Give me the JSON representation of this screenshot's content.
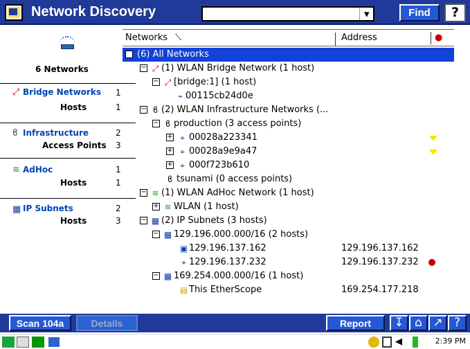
{
  "title": "Network Discovery",
  "search": {
    "placeholder": ""
  },
  "find": "Find",
  "help": "?",
  "left": {
    "count": "6 Networks",
    "bridge": "Bridge Networks",
    "bridge_count": "1",
    "bridge_hosts_label": "Hosts",
    "bridge_hosts": "1",
    "infra": "Infrastructure",
    "infra_count": "2",
    "infra_ap_label": "Access Points",
    "infra_ap": "3",
    "adhoc": "AdHoc",
    "adhoc_count": "1",
    "adhoc_hosts_label": "Hosts",
    "adhoc_hosts": "1",
    "subnet": "IP Subnets",
    "subnet_count": "2",
    "subnet_hosts_label": "Hosts",
    "subnet_hosts": "3"
  },
  "columns": {
    "networks": "Networks",
    "address": "Address"
  },
  "rows": [
    {
      "text": "(6) All Networks",
      "addr": "",
      "marker": ""
    },
    {
      "text": "(1) WLAN Bridge Network (1 host)",
      "addr": "",
      "marker": ""
    },
    {
      "text": "[bridge:1] (1 host)",
      "addr": "",
      "marker": ""
    },
    {
      "text": "00115cb24d0e",
      "addr": "",
      "marker": ""
    },
    {
      "text": "(2) WLAN Infrastructure Networks (...",
      "addr": "",
      "marker": ""
    },
    {
      "text": "production (3 access points)",
      "addr": "",
      "marker": ""
    },
    {
      "text": "00028a223341",
      "addr": "",
      "marker": "triangle"
    },
    {
      "text": "00028a9e9a47",
      "addr": "",
      "marker": "triangle"
    },
    {
      "text": "000f723b610",
      "addr": "",
      "marker": ""
    },
    {
      "text": "tsunami (0 access points)",
      "addr": "",
      "marker": ""
    },
    {
      "text": "(1) WLAN AdHoc Network (1 host)",
      "addr": "",
      "marker": ""
    },
    {
      "text": "WLAN (1 host)",
      "addr": "",
      "marker": ""
    },
    {
      "text": "(2) IP Subnets (3 hosts)",
      "addr": "",
      "marker": ""
    },
    {
      "text": "129.196.000.000/16 (2 hosts)",
      "addr": "",
      "marker": ""
    },
    {
      "text": "129.196.137.162",
      "addr": "129.196.137.162",
      "marker": ""
    },
    {
      "text": "129.196.137.232",
      "addr": "129.196.137.232",
      "marker": "dot"
    },
    {
      "text": "169.254.000.000/16 (1 host)",
      "addr": "",
      "marker": ""
    },
    {
      "text": "This EtherScope",
      "addr": "169.254.177.218",
      "marker": ""
    }
  ],
  "buttons": {
    "scan": "Scan 104a",
    "details": "Details",
    "report": "Report"
  },
  "time": "2:39 PM"
}
